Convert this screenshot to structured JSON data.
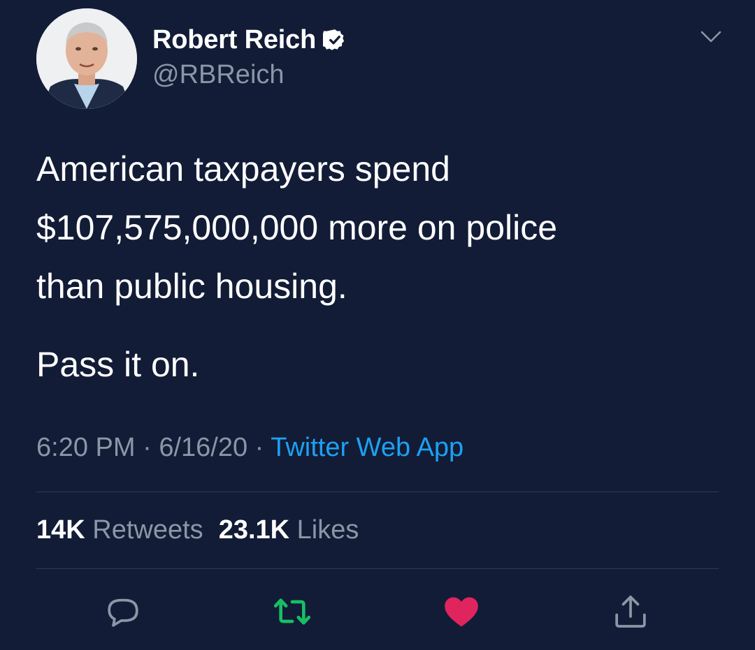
{
  "author": {
    "name": "Robert Reich",
    "handle": "@RBReich",
    "verified": true,
    "avatar_icon": "profile-photo"
  },
  "tweet": {
    "text_lines": [
      "American taxpayers spend",
      "$107,575,000,000 more on police",
      "than public housing."
    ],
    "text_para2": "Pass it on.",
    "time": "6:20 PM",
    "separator": "·",
    "date": "6/16/20",
    "source": "Twitter Web App"
  },
  "stats": {
    "retweets_count": "14K",
    "retweets_label": "Retweets",
    "likes_count": "23.1K",
    "likes_label": "Likes"
  },
  "actions": [
    {
      "icon": "reply-icon"
    },
    {
      "icon": "retweet-icon",
      "color": "#17bf63"
    },
    {
      "icon": "like-icon",
      "color": "#e0245e"
    },
    {
      "icon": "share-icon"
    }
  ],
  "colors": {
    "background": "#121c36",
    "secondary_text": "#8a97a6",
    "link": "#1da1f2",
    "retweet_active": "#17bf63",
    "like_active": "#e0245e"
  }
}
